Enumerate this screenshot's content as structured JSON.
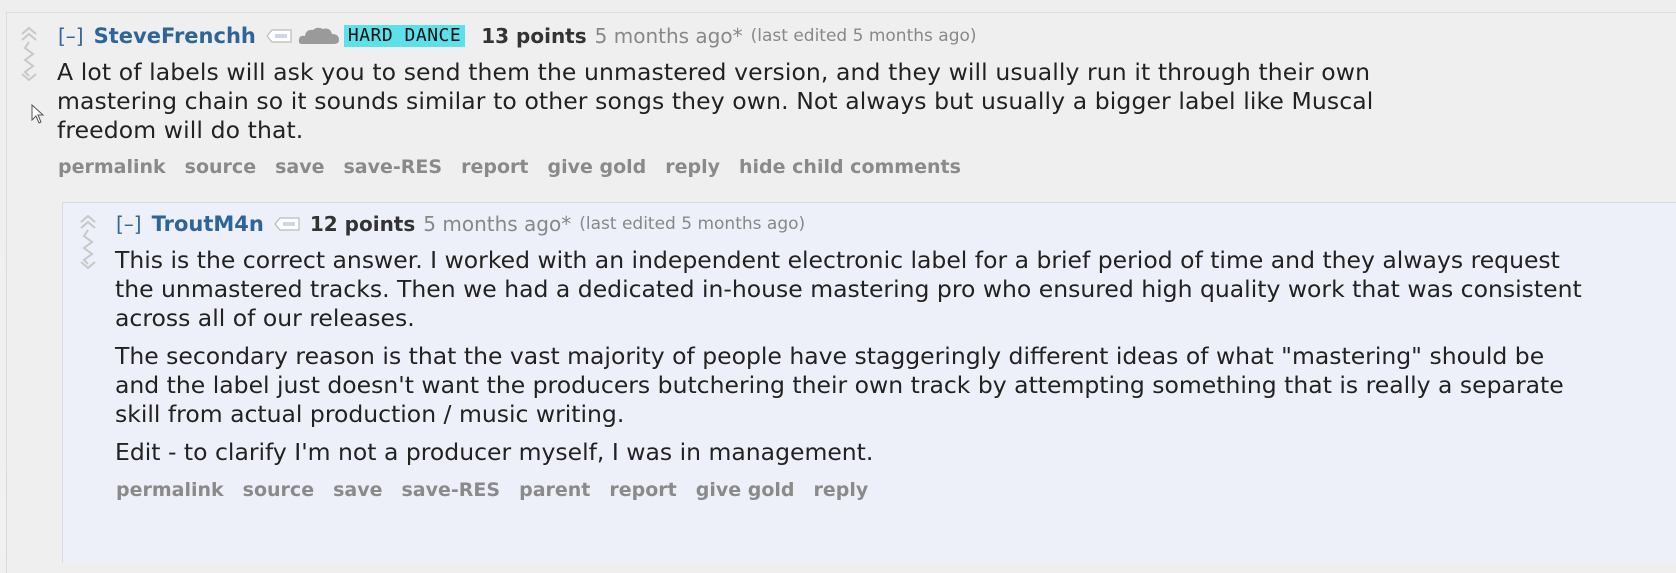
{
  "comment": {
    "expand_label": "[–]",
    "author": "SteveFrenchh",
    "flair": "HARD DANCE",
    "points": "13 points",
    "time": "5 months ago*",
    "edited": "(last edited 5 months ago)",
    "paragraphs": [
      "A lot of labels will ask you to send them the unmastered version, and they will usually run it through their own mastering chain so it sounds similar to other songs they own. Not always but usually a bigger label like Muscal freedom will do that."
    ],
    "buttons": [
      "permalink",
      "source",
      "save",
      "save-RES",
      "report",
      "give gold",
      "reply",
      "hide child comments"
    ]
  },
  "reply": {
    "expand_label": "[–]",
    "author": "TroutM4n",
    "points": "12 points",
    "time": "5 months ago*",
    "edited": "(last edited 5 months ago)",
    "paragraphs": [
      "This is the correct answer. I worked with an independent electronic label for a brief period of time and they always request the unmastered tracks. Then we had a dedicated in-house mastering pro who ensured high quality work that was consistent across all of our releases.",
      "The secondary reason is that the vast majority of people have staggeringly different ideas of what \"mastering\" should be and the label just doesn't want the producers butchering their own track by attempting something that is really a separate skill from actual production / music writing.",
      "Edit - to clarify I'm not a producer myself, I was in management."
    ],
    "buttons": [
      "permalink",
      "source",
      "save",
      "save-RES",
      "parent",
      "report",
      "give gold",
      "reply"
    ]
  },
  "icons": {
    "vote": "vote-arrows-icon",
    "user_tag": "user-tag-icon",
    "cloud": "cloud-icon",
    "cursor": "mouse-cursor-icon"
  },
  "colors": {
    "author": "#2f6498",
    "flair_bg": "#5ce0ea",
    "child_bg": "#eef0f9",
    "button_text": "#8a8a8a"
  }
}
